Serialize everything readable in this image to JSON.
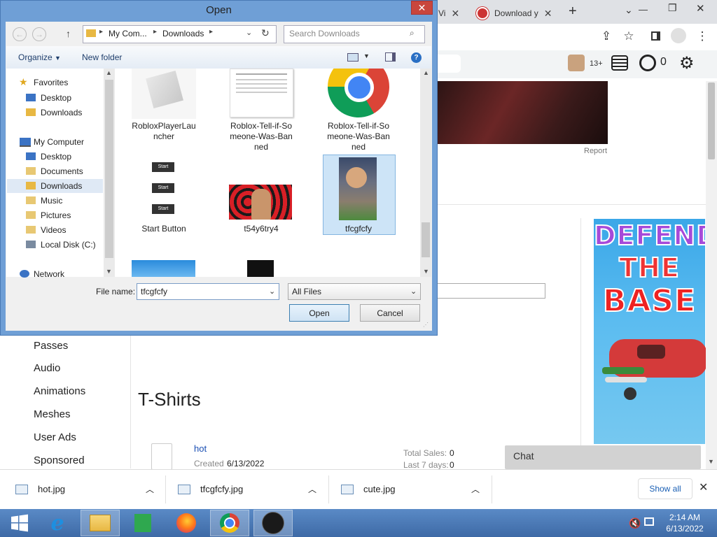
{
  "browser": {
    "tabs": [
      {
        "label": "Vi",
        "close": "✕"
      },
      {
        "label": "Download y",
        "close": "✕"
      }
    ],
    "new_tab": "+",
    "window_controls": {
      "tabsearch": "⌄",
      "minimize": "—",
      "restore": "❐",
      "close": "✕"
    }
  },
  "roblox_header": {
    "age_badge": "13+",
    "robux": "0"
  },
  "sidebar": {
    "items": [
      "Passes",
      "Audio",
      "Animations",
      "Meshes",
      "User Ads",
      "Sponsored"
    ]
  },
  "main": {
    "title": "T-Shirts",
    "report_link": "Report",
    "item": {
      "name": "hot",
      "created_label": "Created",
      "created_date": "6/13/2022",
      "total_sales_label": "Total Sales:",
      "total_sales": "0",
      "last7_label": "Last 7 days:",
      "last7": "0"
    },
    "ad_text": [
      "DEFEND",
      "THE",
      "BASE"
    ],
    "chat_label": "Chat"
  },
  "downloads": {
    "items": [
      "hot.jpg",
      "tfcgfcfy.jpg",
      "cute.jpg"
    ],
    "show_all": "Show all",
    "close": "✕"
  },
  "taskbar": {
    "time": "2:14 AM",
    "date": "6/13/2022"
  },
  "dialog": {
    "title": "Open",
    "close": "✕",
    "breadcrumb": [
      "My Com...",
      "Downloads"
    ],
    "search_placeholder": "Search Downloads",
    "organize": "Organize",
    "new_folder": "New folder",
    "nav": {
      "favorites": "Favorites",
      "fav_items": [
        "Desktop",
        "Downloads"
      ],
      "computer": "My Computer",
      "computer_items": [
        "Desktop",
        "Documents",
        "Downloads",
        "Music",
        "Pictures",
        "Videos",
        "Local Disk (C:)"
      ],
      "network": "Network"
    },
    "files": [
      {
        "name": "RobloxPlayerLauncher",
        "line1": "RobloxPlayerLau",
        "line2": "ncher",
        "line3": ""
      },
      {
        "name": "Roblox-Tell-if-Someone-Was-Banned",
        "line1": "Roblox-Tell-if-So",
        "line2": "meone-Was-Ban",
        "line3": "ned"
      },
      {
        "name": "Roblox-Tell-if-Someone-Was-Banned-2",
        "line1": "Roblox-Tell-if-So",
        "line2": "meone-Was-Ban",
        "line3": "ned"
      },
      {
        "name": "Start Button",
        "line1": "Start Button",
        "line2": "",
        "line3": ""
      },
      {
        "name": "t54y6try4",
        "line1": "t54y6try4",
        "line2": "",
        "line3": ""
      },
      {
        "name": "tfcgfcfy",
        "line1": "tfcgfcfy",
        "line2": "",
        "line3": ""
      }
    ],
    "start_thumb_text": "Start",
    "file_name_label": "File name:",
    "file_name_value": "tfcgfcfy",
    "file_type": "All Files",
    "open_button": "Open",
    "cancel_button": "Cancel"
  }
}
